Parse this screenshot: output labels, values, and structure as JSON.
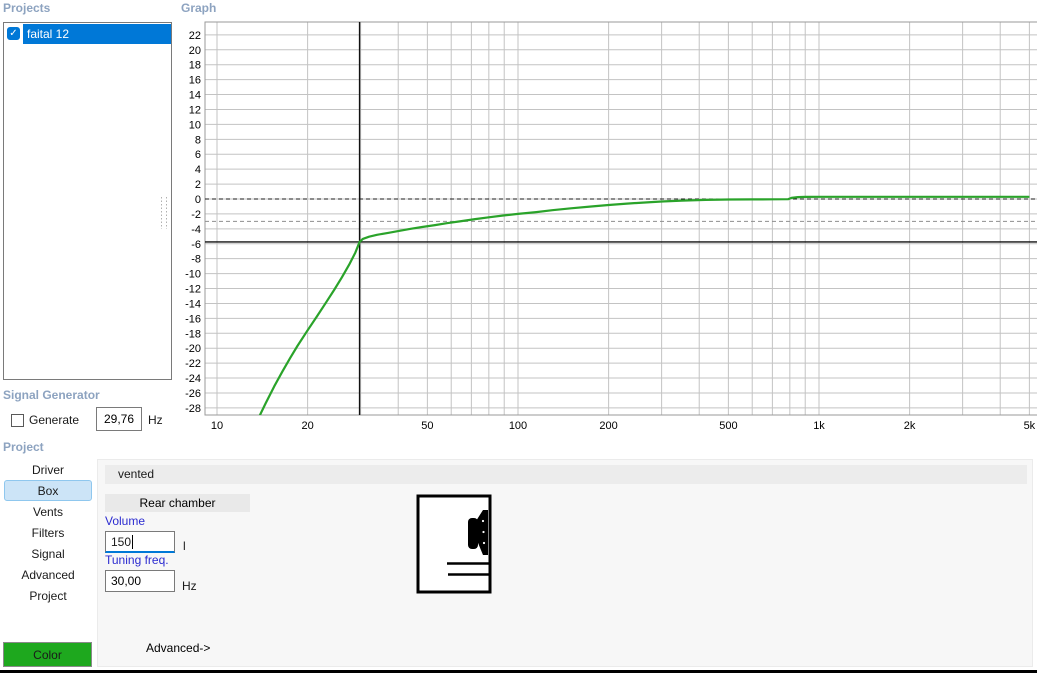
{
  "projects": {
    "title": "Projects",
    "items": [
      {
        "label": "faital 12",
        "checked": true,
        "selected": true
      }
    ]
  },
  "graph": {
    "title": "Graph"
  },
  "signal_generator": {
    "title": "Signal Generator",
    "checkbox_label": "Generate",
    "checked": false,
    "frequency": "29,76",
    "unit": "Hz"
  },
  "project_nav": {
    "title": "Project",
    "tabs": [
      {
        "label": "Driver",
        "selected": false
      },
      {
        "label": "Box",
        "selected": true
      },
      {
        "label": "Vents",
        "selected": false
      },
      {
        "label": "Filters",
        "selected": false
      },
      {
        "label": "Signal",
        "selected": false
      },
      {
        "label": "Advanced",
        "selected": false
      },
      {
        "label": "Project",
        "selected": false
      }
    ]
  },
  "box_panel": {
    "box_type": "vented",
    "rear_chamber_label": "Rear chamber",
    "volume": {
      "label": "Volume",
      "value": "150",
      "unit": "l",
      "focused": true
    },
    "tuning": {
      "label": "Tuning freq.",
      "value": "30,00",
      "unit": "Hz"
    },
    "advanced_label": "Advanced->"
  },
  "color_button": {
    "label": "Color",
    "color": "#1ea81e"
  },
  "selection_color": "#0078d7",
  "chart_data": {
    "type": "line",
    "title": "Graph",
    "x_axis": {
      "scale": "log",
      "unit": "Hz",
      "range": [
        9.1,
        5300
      ],
      "ticks": [
        {
          "v": 10,
          "label": "10"
        },
        {
          "v": 20,
          "label": "20"
        },
        {
          "v": 50,
          "label": "50"
        },
        {
          "v": 100,
          "label": "100"
        },
        {
          "v": 200,
          "label": "200"
        },
        {
          "v": 500,
          "label": "500"
        },
        {
          "v": 1000,
          "label": "1k"
        },
        {
          "v": 2000,
          "label": "2k"
        },
        {
          "v": 5000,
          "label": "5k"
        }
      ]
    },
    "y_axis": {
      "unit": "dB",
      "range": [
        -29,
        23.7
      ],
      "tick_step": 2,
      "ticks": [
        22,
        20,
        18,
        16,
        14,
        12,
        10,
        8,
        6,
        4,
        2,
        0,
        -2,
        -4,
        -6,
        -8,
        -10,
        -12,
        -14,
        -16,
        -18,
        -20,
        -22,
        -24,
        -26,
        -28
      ]
    },
    "markers": {
      "zero_db_dashed": 0,
      "minus3_db_dashed": -3,
      "level_solid_db": -5.75,
      "frequency_solid_hz": 29.76
    },
    "grid": true,
    "series": [
      {
        "name": "faital 12",
        "color": "#2aa32a",
        "points": [
          [
            13.5,
            -30
          ],
          [
            14.5,
            -27.4
          ],
          [
            15.5,
            -25.1
          ],
          [
            16.5,
            -23.1
          ],
          [
            17.5,
            -21.3
          ],
          [
            18.5,
            -19.7
          ],
          [
            20,
            -17.6
          ],
          [
            21.5,
            -15.7
          ],
          [
            23,
            -13.9
          ],
          [
            24.5,
            -12.2
          ],
          [
            26,
            -10.5
          ],
          [
            27.5,
            -8.8
          ],
          [
            28.8,
            -7.2
          ],
          [
            29.76,
            -5.75
          ],
          [
            30.5,
            -5.35
          ],
          [
            32,
            -5.05
          ],
          [
            34,
            -4.8
          ],
          [
            37,
            -4.55
          ],
          [
            40,
            -4.3
          ],
          [
            44,
            -4.0
          ],
          [
            48,
            -3.75
          ],
          [
            53,
            -3.5
          ],
          [
            58,
            -3.25
          ],
          [
            64,
            -3.0
          ],
          [
            72,
            -2.7
          ],
          [
            80,
            -2.45
          ],
          [
            90,
            -2.2
          ],
          [
            100,
            -2.0
          ],
          [
            115,
            -1.75
          ],
          [
            130,
            -1.5
          ],
          [
            150,
            -1.25
          ],
          [
            175,
            -1.0
          ],
          [
            200,
            -0.8
          ],
          [
            230,
            -0.62
          ],
          [
            260,
            -0.48
          ],
          [
            300,
            -0.33
          ],
          [
            350,
            -0.22
          ],
          [
            420,
            -0.12
          ],
          [
            500,
            -0.07
          ],
          [
            600,
            -0.05
          ],
          [
            700,
            -0.04
          ],
          [
            790,
            -0.03
          ],
          [
            810,
            0.15
          ],
          [
            850,
            0.25
          ],
          [
            900,
            0.28
          ],
          [
            1000,
            0.3
          ],
          [
            1500,
            0.3
          ],
          [
            2000,
            0.3
          ],
          [
            3000,
            0.3
          ],
          [
            4000,
            0.3
          ],
          [
            5000,
            0.3
          ]
        ]
      }
    ]
  }
}
